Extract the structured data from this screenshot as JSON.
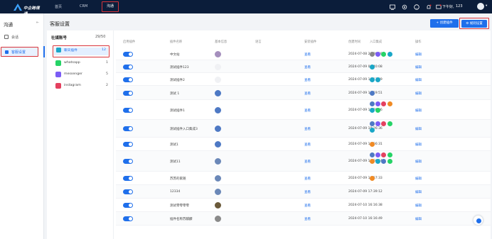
{
  "topbar": {
    "logo_text": "中企跨境通",
    "nav": [
      "首页",
      "CRM",
      "沟通"
    ],
    "time_greeting": "下午好,",
    "user": "123",
    "icons": [
      "screen-icon",
      "settings-icon",
      "help-icon",
      "notification-icon",
      "message-icon"
    ]
  },
  "sidebar": {
    "title": "沟通",
    "items": [
      {
        "label": "会话",
        "icon": "chat-icon"
      },
      {
        "label": "客服设置",
        "icon": "service-icon"
      }
    ]
  },
  "main": {
    "title": "客服设置",
    "buttons": {
      "create": "+ 创建插件",
      "rule": "⚙ 规则设置"
    }
  },
  "accounts": {
    "header": "社媒账号",
    "count": "29/50",
    "items": [
      {
        "label": "聊天插件",
        "count": "12",
        "color": "#1aa7c7"
      },
      {
        "label": "whatsapp",
        "count": "1",
        "color": "#25d366"
      },
      {
        "label": "messenger",
        "count": "5",
        "color": "#7b5cf5"
      },
      {
        "label": "instagram",
        "count": "2",
        "color": "#e4405f"
      }
    ]
  },
  "table": {
    "columns": [
      "启用插件",
      "插件名称",
      "基本信息",
      "语言",
      "安装插件",
      "创建时间",
      "入口集成",
      "操作"
    ],
    "rows": [
      {
        "name": "中文站",
        "install": "查看",
        "created": "2024-07-08 20:36:50",
        "op": "编辑",
        "avatar": "#a58fbd",
        "channels": [
          "#888",
          "#7b5cf5",
          "#25d366",
          "#1aa7c7"
        ]
      },
      {
        "name": "测试插件123",
        "install": "查看",
        "created": "2024-07-09 09:40:08",
        "op": "编辑",
        "avatar": "#f0f1f4",
        "channels": [
          "#1aa7c7"
        ]
      },
      {
        "name": "测试插件2",
        "install": "查看",
        "created": "2024-07-09 10:13:39",
        "op": "编辑",
        "avatar": "#f0f1f4",
        "channels": [
          "#1aa7c7",
          "#1aa7c7"
        ]
      },
      {
        "name": "测试 1",
        "install": "查看",
        "created": "2024-07-09 10:19:51",
        "op": "编辑",
        "avatar": "#4e79c4",
        "channels": [
          "#4e79c4"
        ]
      },
      {
        "name": "测试插件1",
        "install": "查看",
        "created": "2024-07-09 10:20:06",
        "op": "编辑",
        "avatar": "#4e79c4",
        "channels": [
          "#4e79c4",
          "#7b5cf5",
          "#e4405f",
          "#f08a24",
          "#1aa7c7",
          "#25d366"
        ]
      },
      {
        "name": "测试插件入口集成3",
        "install": "查看",
        "created": "2024-07-09 10:26:36",
        "op": "编辑",
        "avatar": "#4e79c4",
        "channels": [
          "#4e79c4",
          "#7b5cf5",
          "#e4405f",
          "#25d366",
          "#1aa7c7"
        ]
      },
      {
        "name": "测试1",
        "install": "查看",
        "created": "2024-07-09 10:56:31",
        "op": "编辑",
        "avatar": "#4e79c4",
        "channels": [
          "#f08a24"
        ]
      },
      {
        "name": "测试11",
        "install": "查看",
        "created": "2024-07-09 10:56:54",
        "op": "编辑",
        "avatar": "#6b88b8",
        "channels": [
          "#4e79c4",
          "#7b5cf5",
          "#e4405f",
          "#25d366",
          "#f08a24",
          "#1aa7c7",
          "#4e79c4",
          "#25d366"
        ]
      },
      {
        "name": "苏苏的家随",
        "install": "查看",
        "created": "2024-07-09 10:57:33",
        "op": "编辑",
        "avatar": "#6b88b8",
        "channels": [
          "#f08a24"
        ]
      },
      {
        "name": "12334",
        "install": "查看",
        "created": "2024-07-09 17:39:12",
        "op": "编辑",
        "avatar": "#6b88b8",
        "channels": []
      },
      {
        "name": "测试零零零零",
        "install": "查看",
        "created": "2024-07-10 16:16:38",
        "op": "编辑",
        "avatar": "#6b5a3a",
        "channels": []
      },
      {
        "name": "插件名称苏麒麟",
        "install": "查看",
        "created": "2024-07-10 16:16:49",
        "op": "编辑",
        "avatar": "#8a8a8a",
        "channels": []
      }
    ]
  },
  "colors": {
    "accent": "#1f6feb",
    "highlight": "#d8343a",
    "topbar": "#0b1d3a"
  }
}
